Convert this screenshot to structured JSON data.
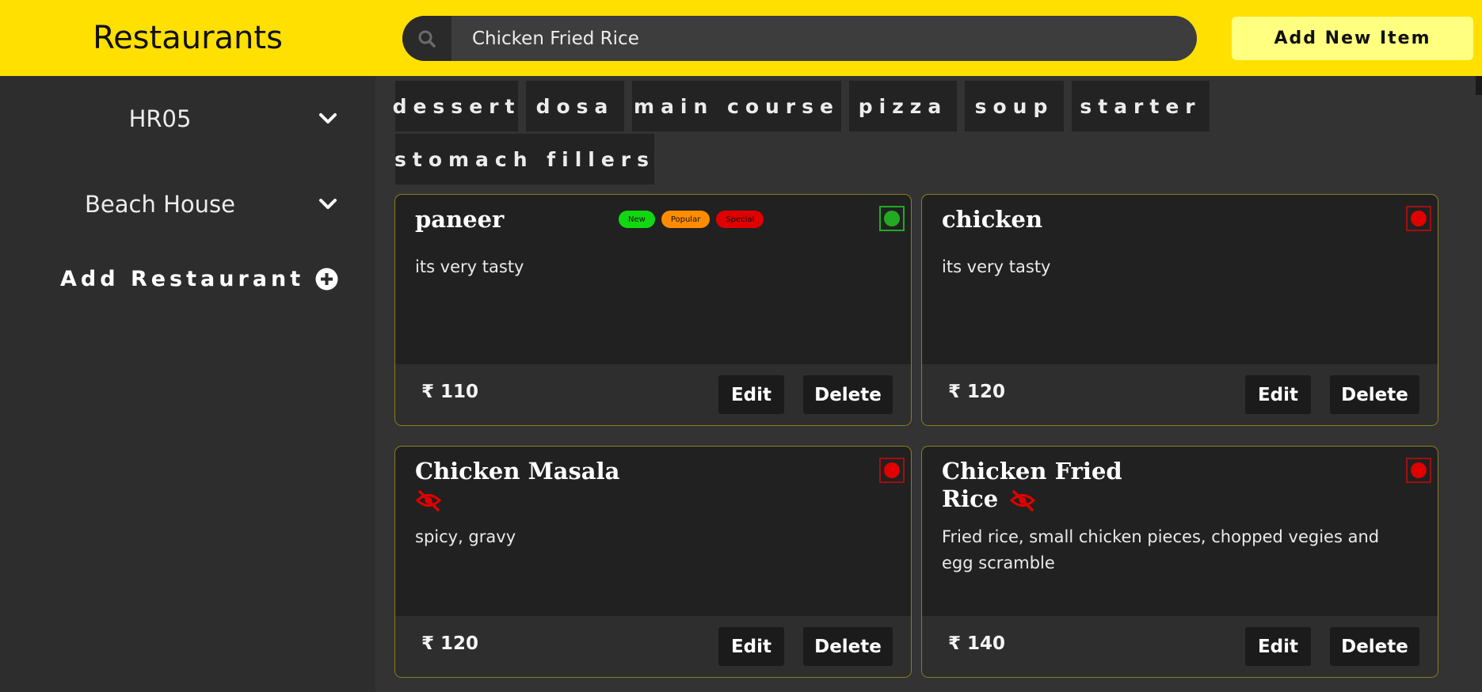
{
  "header": {
    "brand": "Restaurants",
    "search_value": "Chicken Fried Rice",
    "add_item_label": "Add New Item"
  },
  "sidebar": {
    "restaurants": [
      {
        "name": "HR05"
      },
      {
        "name": "Beach House"
      }
    ],
    "add_restaurant_label": "Add Restaurant"
  },
  "categories": [
    "dessert",
    "dosa",
    "main course",
    "pizza",
    "soup",
    "starter",
    "stomach fillers"
  ],
  "badges": [
    {
      "label": "New",
      "color": "#11d811"
    },
    {
      "label": "Popular",
      "color": "#ff8c00"
    },
    {
      "label": "Special",
      "color": "#e00000"
    }
  ],
  "items": [
    {
      "name": "paneer",
      "description": "its very tasty",
      "price": "₹ 110",
      "veg": true,
      "hidden": false
    },
    {
      "name": "chicken",
      "description": "its very tasty",
      "price": "₹ 120",
      "veg": false,
      "hidden": false
    },
    {
      "name": "Chicken Masala",
      "description": "spicy, gravy",
      "price": "₹ 120",
      "veg": false,
      "hidden": true
    },
    {
      "name_line1": "Chicken Fried",
      "name_line2": "Rice",
      "description": "Fried rice, small chicken pieces, chopped vegies and egg scramble",
      "price": "₹ 140",
      "veg": false,
      "hidden": true
    }
  ],
  "buttons": {
    "edit": "Edit",
    "delete": "Delete"
  },
  "colors": {
    "header_bg": "#ffe000",
    "add_button_bg": "#ffff80",
    "veg_green": "#22aa22",
    "nonveg_red": "#e00000",
    "card_border": "#8a7d20"
  },
  "icons": {
    "search": "search-icon",
    "chevron": "chevron-down-icon",
    "add": "plus-circle-icon",
    "hidden": "eye-slash-icon"
  }
}
